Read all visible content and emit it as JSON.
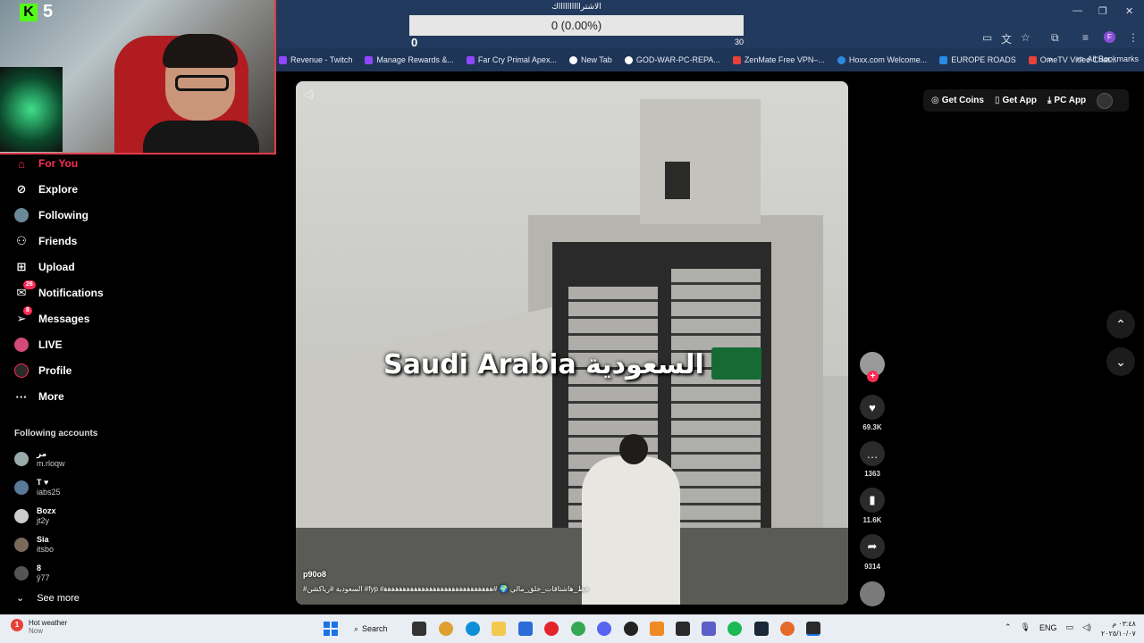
{
  "goal": {
    "title": "الاشترااااااااااك",
    "progress_text": "0 (0.00%)",
    "min": "0",
    "max": "30"
  },
  "kick": {
    "logo": "K",
    "count": "5"
  },
  "browser": {
    "bookmarks": [
      {
        "label": "Revenue - Twitch",
        "color": "#9146ff"
      },
      {
        "label": "Manage Rewards &...",
        "color": "#9146ff"
      },
      {
        "label": "Far Cry Primal Apex...",
        "color": "#9146ff"
      },
      {
        "label": "New Tab",
        "color": "#ffffff"
      },
      {
        "label": "GOD-WAR-PC-REPA...",
        "color": "#ffffff"
      },
      {
        "label": "ZenMate Free VPN–...",
        "color": "#e8413a"
      },
      {
        "label": "Hoxx.com Welcome...",
        "color": "#2b8ae2"
      },
      {
        "label": "EUROPE ROADS",
        "color": "#2b8ae2"
      },
      {
        "label": "OmeTV Video Chat...",
        "color": "#e8413a"
      }
    ],
    "more": "»",
    "all_bookmarks": "All Bookmarks"
  },
  "sidebar": {
    "items": [
      {
        "label": "For You",
        "icon": "home-icon",
        "glyph": "⌂"
      },
      {
        "label": "Explore",
        "icon": "compass-icon",
        "glyph": "⊘"
      },
      {
        "label": "Following",
        "icon": "following-avatar-icon",
        "glyph": "●"
      },
      {
        "label": "Friends",
        "icon": "friends-icon",
        "glyph": "⚇"
      },
      {
        "label": "Upload",
        "icon": "upload-icon",
        "glyph": "⊞"
      },
      {
        "label": "Notifications",
        "icon": "inbox-icon",
        "glyph": "✉",
        "badge": "26"
      },
      {
        "label": "Messages",
        "icon": "send-icon",
        "glyph": "➢",
        "badge": "8"
      },
      {
        "label": "LIVE",
        "icon": "live-icon",
        "glyph": "◉"
      },
      {
        "label": "Profile",
        "icon": "profile-icon",
        "glyph": "◍"
      },
      {
        "label": "More",
        "icon": "more-dots-icon",
        "glyph": "···"
      }
    ],
    "following_title": "Following accounts",
    "accounts": [
      {
        "name": "ﻣﺮ",
        "user": "m.rloqw"
      },
      {
        "name": "T ♥",
        "user": "iabs25"
      },
      {
        "name": "Bozx",
        "user": "jt2y"
      },
      {
        "name": "Sia",
        "user": "itsbo"
      },
      {
        "name": "8",
        "user": "ŷ77"
      }
    ],
    "see_more": "See more"
  },
  "topbar": {
    "get_coins": "Get Coins",
    "get_app": "Get App",
    "pc_app": "PC App"
  },
  "video": {
    "caption": "Saudi Arabia السعودية",
    "author": "p90o8",
    "tags": "#السعودية #رياكشن #fyp #حط_هاشتاقات_خلق_مالي 🌍 #ﻫﻫﻫﻫﻫﻫﻫﻫﻫﻫﻫﻫﻫﻫﻫﻫﻫﻫﻫﻫﻫﻫﻫﻫﻫﻫﻫﻫﻫ"
  },
  "actions": {
    "likes": "69.3K",
    "comments": "1363",
    "saves": "11.6K",
    "shares": "9314"
  },
  "taskbar": {
    "weather_title": "Hot weather",
    "weather_sub": "Now",
    "weather_badge": "1",
    "search": "Search",
    "lang": "ENG",
    "time": "٠٣:٤٨ م",
    "date": "٢٠٢٥/١٠/٠٧"
  },
  "colors": {
    "accent": "#fe2c55",
    "chrome": "#223a5e",
    "kick": "#53fc18"
  }
}
